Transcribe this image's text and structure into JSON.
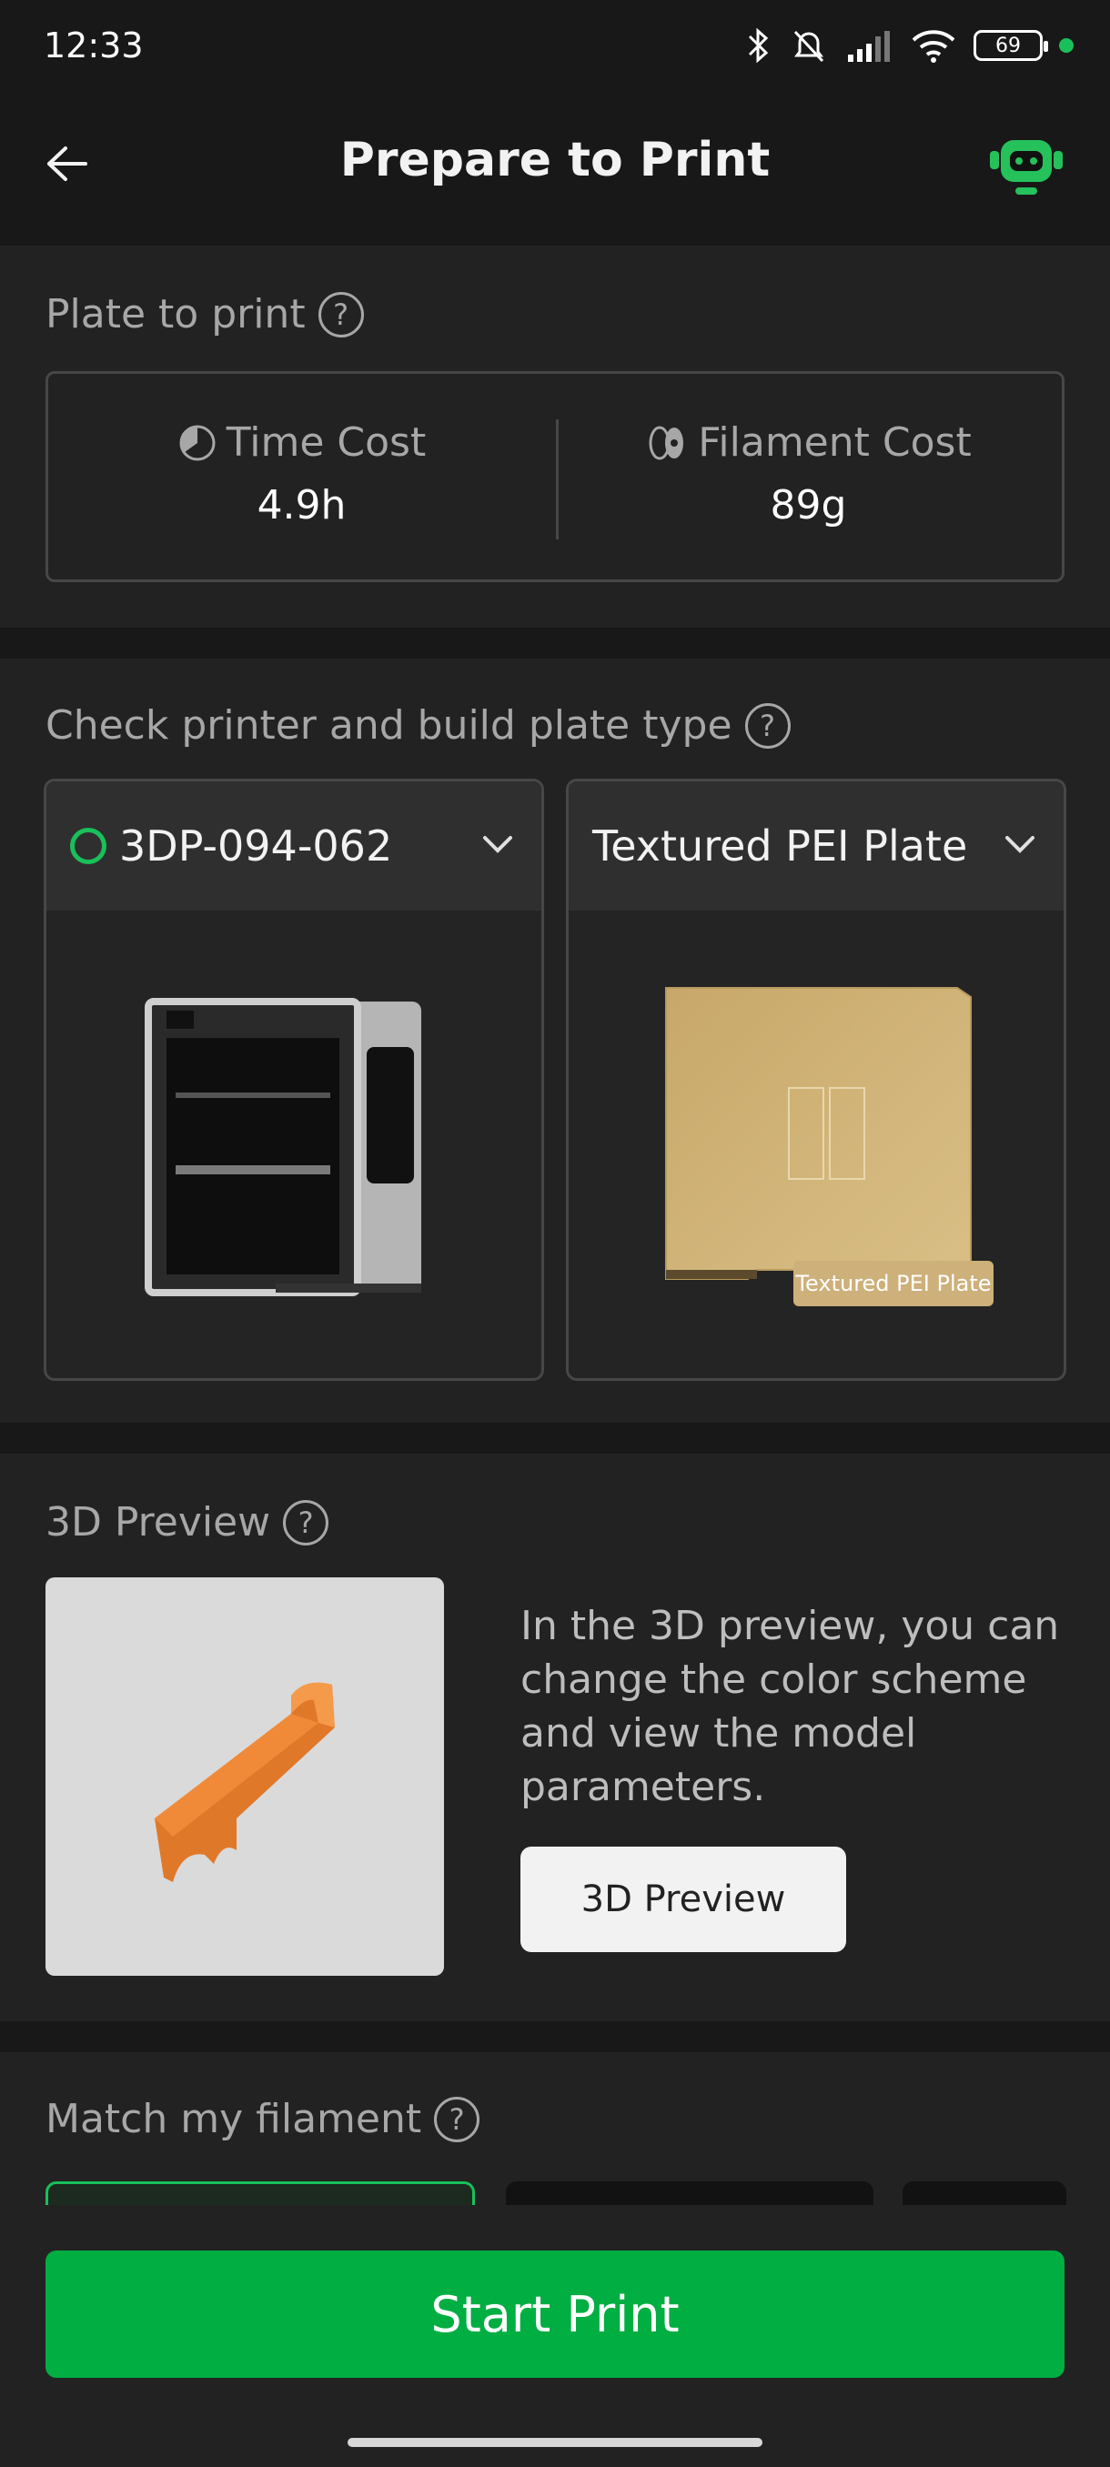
{
  "status_bar": {
    "time": "12:33",
    "battery": "69"
  },
  "header": {
    "title": "Prepare to Print"
  },
  "plate_section": {
    "title": "Plate to print",
    "time_cost_label": "Time Cost",
    "time_cost_value": "4.9h",
    "filament_cost_label": "Filament Cost",
    "filament_cost_value": "89g"
  },
  "printer_section": {
    "title": "Check printer and build plate type",
    "printer_name": "3DP-094-062",
    "plate_type": "Textured PEI Plate",
    "plate_image_label": "Textured PEI Plate"
  },
  "preview_section": {
    "title": "3D Preview",
    "description": "In the 3D preview, you can change the color scheme and view the model parameters.",
    "button_label": "3D Preview"
  },
  "filament_section": {
    "title": "Match my filament"
  },
  "footer": {
    "start_label": "Start Print"
  },
  "colors": {
    "accent": "#00ae42",
    "status_green": "#19c05a",
    "background": "#181818",
    "panel": "#222222"
  }
}
